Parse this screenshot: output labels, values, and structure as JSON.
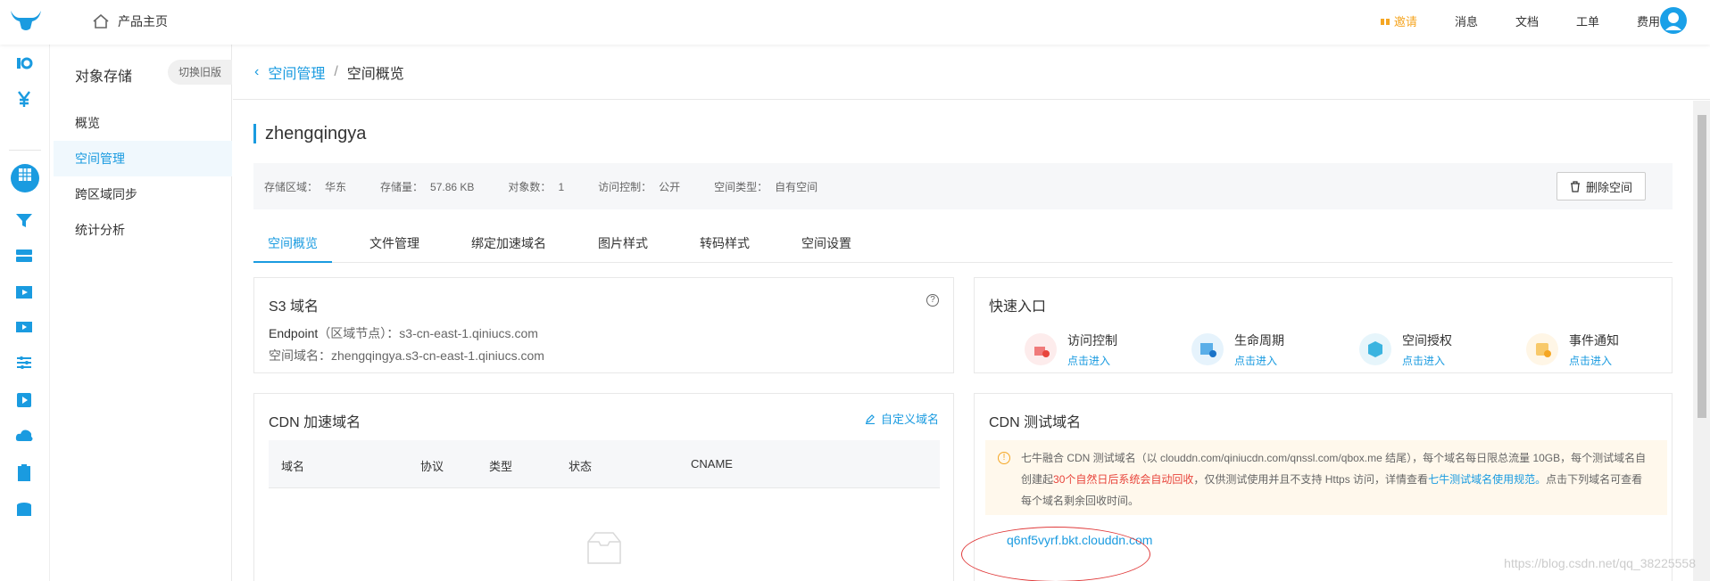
{
  "topbar": {
    "home_label": "产品主页",
    "invite_label": "邀请",
    "nav": [
      "消息",
      "文档",
      "工单",
      "费用"
    ]
  },
  "subnav": {
    "title": "对象存储",
    "switch_label": "切换旧版",
    "items": [
      {
        "label": "概览",
        "active": false
      },
      {
        "label": "空间管理",
        "active": true
      },
      {
        "label": "跨区域同步",
        "active": false
      },
      {
        "label": "统计分析",
        "active": false
      }
    ]
  },
  "breadcrumb": {
    "parent": "空间管理",
    "separator": "/",
    "current": "空间概览"
  },
  "bucket": {
    "name": "zhengqingya",
    "region_label": "存储区域：",
    "region_value": "华东",
    "storage_label": "存储量：",
    "storage_value": "57.86 KB",
    "objects_label": "对象数：",
    "objects_value": "1",
    "access_label": "访问控制：",
    "access_value": "公开",
    "type_label": "空间类型：",
    "type_value": "自有空间",
    "delete_label": "删除空间"
  },
  "tabs": [
    {
      "label": "空间概览",
      "active": true
    },
    {
      "label": "文件管理",
      "active": false
    },
    {
      "label": "绑定加速域名",
      "active": false
    },
    {
      "label": "图片样式",
      "active": false
    },
    {
      "label": "转码样式",
      "active": false
    },
    {
      "label": "空间设置",
      "active": false
    }
  ],
  "s3": {
    "title": "S3 域名",
    "endpoint_key": "Endpoint",
    "endpoint_paren": "（区域节点）：",
    "endpoint_value": "s3-cn-east-1.qiniucs.com",
    "domain_key": "空间域名：",
    "domain_value": "zhengqingya.s3-cn-east-1.qiniucs.com"
  },
  "quick": {
    "title": "快速入口",
    "items": [
      {
        "label": "访问控制",
        "link": "点击进入",
        "color": "#fdecec"
      },
      {
        "label": "生命周期",
        "link": "点击进入",
        "color": "#e6f3fc"
      },
      {
        "label": "空间授权",
        "link": "点击进入",
        "color": "#e6f5fb"
      },
      {
        "label": "事件通知",
        "link": "点击进入",
        "color": "#fff6e6"
      }
    ]
  },
  "cdn": {
    "title": "CDN 加速域名",
    "custom_link": "自定义域名",
    "columns": [
      "域名",
      "协议",
      "类型",
      "状态",
      "CNAME"
    ]
  },
  "cdn_test": {
    "title": "CDN 测试域名",
    "notice_1": "七牛融合 CDN 测试域名（以 clouddn.com/qiniucdn.com/qnssl.com/qbox.me 结尾），每个域名每日限总流量 10GB，每个测试域名自创建起",
    "notice_red": "30个自然日后系统会自动回收",
    "notice_2": "，仅供测试使用并且不支持 Https 访问，详情查看",
    "notice_link": "七牛测试域名使用规范。",
    "notice_3": "点击下列域名可查看每个域名剩余回收时间。",
    "domain": "q6nf5vyrf.bkt.clouddn.com"
  },
  "watermark": "https://blog.csdn.net/qq_38225558",
  "colors": {
    "accent": "#1a9be0",
    "warning": "#f5a623",
    "danger": "#e8453c"
  }
}
